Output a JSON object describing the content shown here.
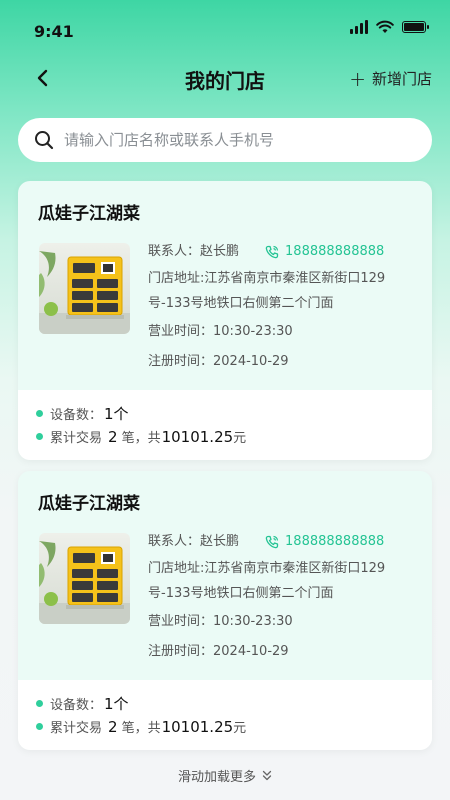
{
  "status": {
    "time": "9:41"
  },
  "nav": {
    "title": "我的门店",
    "add_label": "新增门店"
  },
  "search": {
    "placeholder": "请输入门店名称或联系人手机号"
  },
  "stores": [
    {
      "name": "瓜娃子江湖菜",
      "contact_label": "联系人：",
      "contact_name": "赵长鹏",
      "phone": "188888888888",
      "address_label": "门店地址:",
      "address": "江苏省南京市秦淮区新街口129号-133号地铁口右侧第二个门面",
      "hours_label": "营业时间：",
      "hours": "10:30-23:30",
      "reg_label": "注册时间：",
      "reg_date": "2024-10-29",
      "device_label": "设备数：",
      "device_count": "1个",
      "trans_label": "累计交易",
      "trans_count": "2",
      "trans_mid": "笔，共",
      "trans_amount": "10101.25",
      "trans_unit": "元"
    },
    {
      "name": "瓜娃子江湖菜",
      "contact_label": "联系人：",
      "contact_name": "赵长鹏",
      "phone": "188888888888",
      "address_label": "门店地址:",
      "address": "江苏省南京市秦淮区新街口129号-133号地铁口右侧第二个门面",
      "hours_label": "营业时间：",
      "hours": "10:30-23:30",
      "reg_label": "注册时间：",
      "reg_date": "2024-10-29",
      "device_label": "设备数：",
      "device_count": "1个",
      "trans_label": "累计交易",
      "trans_count": "2",
      "trans_mid": "笔，共",
      "trans_amount": "10101.25",
      "trans_unit": "元"
    }
  ],
  "footer": {
    "load_more": "滑动加载更多"
  },
  "colors": {
    "accent": "#2fcf9c",
    "phone": "#25c494",
    "header_green": "#3ed6a4"
  },
  "icons": [
    "signal-icon",
    "wifi-icon",
    "battery-icon",
    "back-arrow-icon",
    "plus-icon",
    "search-icon",
    "phone-icon",
    "charger-image",
    "chevron-double-down-icon"
  ]
}
